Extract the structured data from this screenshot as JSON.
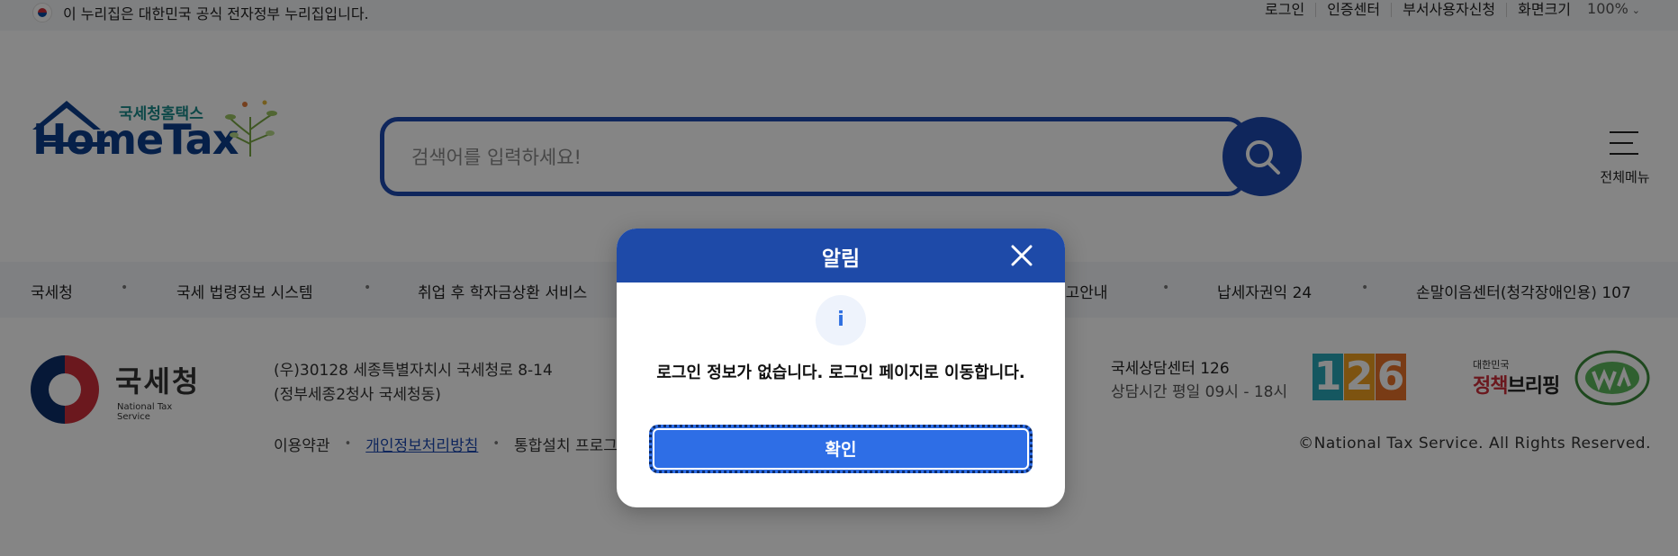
{
  "gov_banner": {
    "text": "이 누리집은 대한민국 공식 전자정부 누리집입니다.",
    "util": {
      "login": "로그인",
      "cert_center": "인증센터",
      "dept_user_apply": "부서사용자신청",
      "zoom_label": "화면크기",
      "zoom_value": "100%"
    }
  },
  "header": {
    "logo": {
      "brand_ko": "국세청홈택스",
      "brand_en": "HomeTax"
    },
    "search": {
      "placeholder": "검색어를 입력하세요!",
      "value": ""
    },
    "all_menu_label": "전체메뉴"
  },
  "related_links": [
    "국세청",
    "국세 법령정보 시스템",
    "취업 후 학자금상환 서비스",
    "신고안내",
    "납세자권익 24",
    "손말이음센터(청각장애인용) 107"
  ],
  "footer": {
    "org_ko": "국세청",
    "org_en": "National Tax Service",
    "address_line1": "(우)30128 세종특별자치시 국세청로 8-14",
    "address_line2": "(정부세종2청사 국세청동)",
    "links": [
      "이용약관",
      "개인정보처리방침",
      "통합설치 프로그램"
    ],
    "center_title": "국세상담센터 126",
    "center_hours": "상담시간 평일 09시 - 18시",
    "badge_digits": [
      "1",
      "2",
      "6"
    ],
    "policy_small": "대한민국",
    "policy_big_part1": "정책",
    "policy_big_part2": "브리핑",
    "copyright": "©National Tax Service. All Rights Reserved."
  },
  "modal": {
    "title": "알림",
    "icon_glyph": "i",
    "message": "로그인 정보가 없습니다. 로그인 페이지로 이동합니다.",
    "confirm_label": "확인"
  },
  "colors": {
    "brand_blue": "#1e4ab0",
    "modal_header": "#1e4aa8",
    "confirm_button": "#2e6ee6",
    "overlay": "rgba(0,0,0,0.48)"
  }
}
